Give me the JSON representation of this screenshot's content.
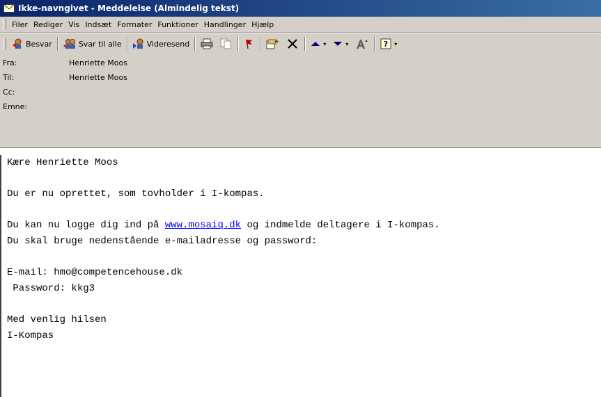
{
  "window": {
    "title": "Ikke-navngivet - Meddelelse (Almindelig tekst)"
  },
  "menubar": {
    "items": [
      "Filer",
      "Rediger",
      "Vis",
      "Indsæt",
      "Formater",
      "Funktioner",
      "Handlinger",
      "Hjælp"
    ]
  },
  "toolbar": {
    "reply_label": "Besvar",
    "reply_all_label": "Svar til alle",
    "forward_label": "Videresend"
  },
  "header": {
    "from_label": "Fra:",
    "from_value": "Henriette Moos",
    "to_label": "Til:",
    "to_value": "Henriette Moos",
    "cc_label": "Cc:",
    "cc_value": "",
    "subject_label": "Emne:",
    "subject_value": ""
  },
  "message": {
    "greeting": "Kære Henriette Moos",
    "line1": "Du er nu oprettet, som tovholder i I-kompas.",
    "line2_pre": "Du kan nu logge dig ind på ",
    "line2_link": "www.mosaiq.dk",
    "line2_post": " og indmelde deltagere i I-kompas.",
    "line3": "Du skal bruge nedenstående e-mailadresse og password:",
    "email_line": "E-mail: hmo@competencehouse.dk",
    "password_line": " Password: kkg3",
    "closing1": "Med venlig hilsen",
    "closing2": "I-Kompas"
  },
  "colors": {
    "titlebar_start": "#0a246a",
    "titlebar_end": "#3a6ea5",
    "chrome": "#d4d0c8",
    "link": "#0000ff"
  },
  "icons": {
    "title": "envelope-icon",
    "reply": "reply-icon",
    "reply_all": "reply-all-icon",
    "forward": "forward-icon",
    "print": "print-icon",
    "copy": "copy-icon",
    "flag": "flag-icon",
    "move": "move-to-folder-icon",
    "delete": "delete-icon",
    "previous": "up-arrow-icon",
    "next": "down-arrow-icon",
    "font": "font-size-icon",
    "help": "help-icon"
  }
}
